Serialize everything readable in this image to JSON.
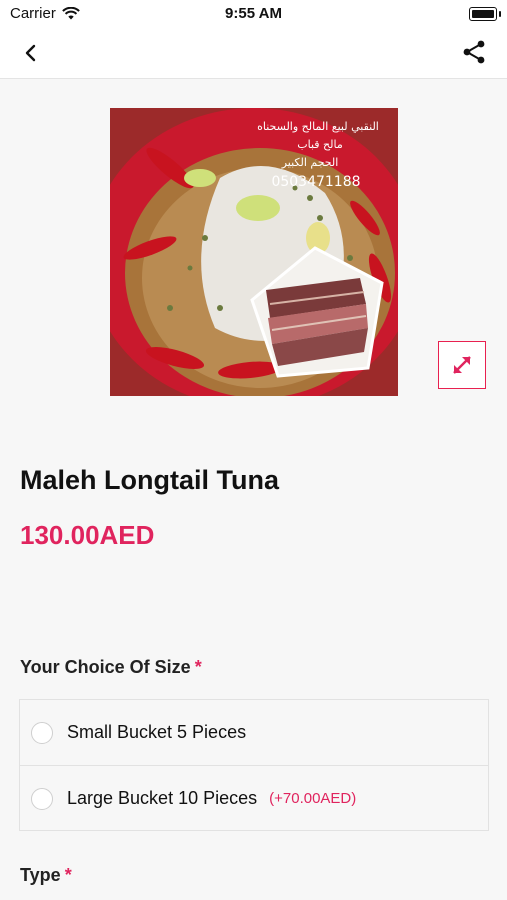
{
  "status_bar": {
    "carrier": "Carrier",
    "time": "9:55 AM"
  },
  "nav": {
    "back_icon": "chevron-left-icon",
    "share_icon": "share-icon"
  },
  "product": {
    "image_overlay": {
      "line1": "النقبي لبيع المالح والسحناه",
      "line2": "مالح قباب",
      "line3": "الحجم الكبير",
      "phone": "0503471188"
    },
    "expand_icon": "expand-icon",
    "title": "Maleh Longtail Tuna",
    "price": "130.00AED"
  },
  "size_section": {
    "label": "Your Choice Of Size",
    "required_mark": "*",
    "options": [
      {
        "label": "Small Bucket 5 Pieces",
        "extra": ""
      },
      {
        "label": "Large Bucket 10 Pieces",
        "extra": "(+70.00AED)"
      }
    ]
  },
  "type_section": {
    "label": "Type",
    "required_mark": "*"
  },
  "colors": {
    "accent": "#e0245e"
  }
}
